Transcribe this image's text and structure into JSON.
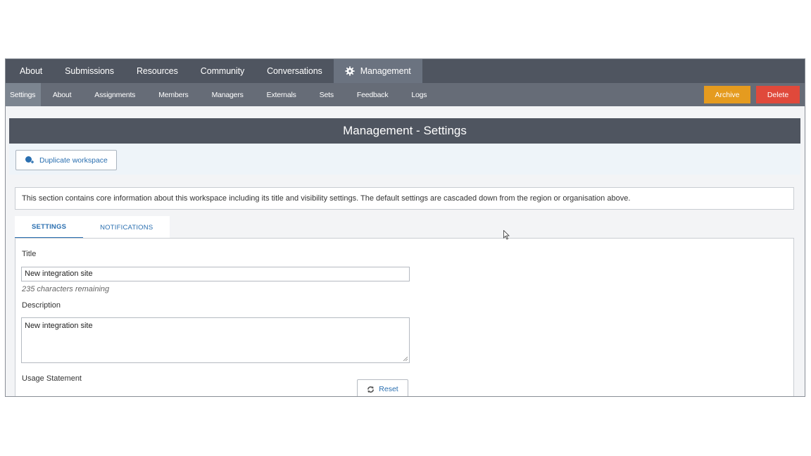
{
  "topnav": {
    "items": [
      "About",
      "Submissions",
      "Resources",
      "Community",
      "Conversations",
      "Management"
    ]
  },
  "subnav": {
    "items": [
      "Settings",
      "About",
      "Assignments",
      "Members",
      "Managers",
      "Externals",
      "Sets",
      "Feedback",
      "Logs"
    ]
  },
  "actions": {
    "archive_label": "Archive",
    "delete_label": "Delete"
  },
  "colors": {
    "archive": "#e59b1f",
    "delete": "#e0493b",
    "nav_dark": "#4f5560",
    "link_blue": "#2a6fb0"
  },
  "panel": {
    "title": "Management - Settings"
  },
  "toolbar": {
    "duplicate_label": "Duplicate workspace",
    "duplicate_icon": "duplicate-icon"
  },
  "info": {
    "text": "This section contains core information about this workspace including its title and visibility settings. The default settings are cascaded down from the region or organisation above."
  },
  "tabs": [
    {
      "label": "SETTINGS"
    },
    {
      "label": "NOTIFICATIONS"
    }
  ],
  "form": {
    "title_label": "Title",
    "title_value": "New integration site",
    "remaining_count": "235",
    "remaining_text": "characters remaining",
    "description_label": "Description",
    "description_value": "New integration site",
    "usage_label": "Usage Statement",
    "reset_label": "Reset"
  }
}
